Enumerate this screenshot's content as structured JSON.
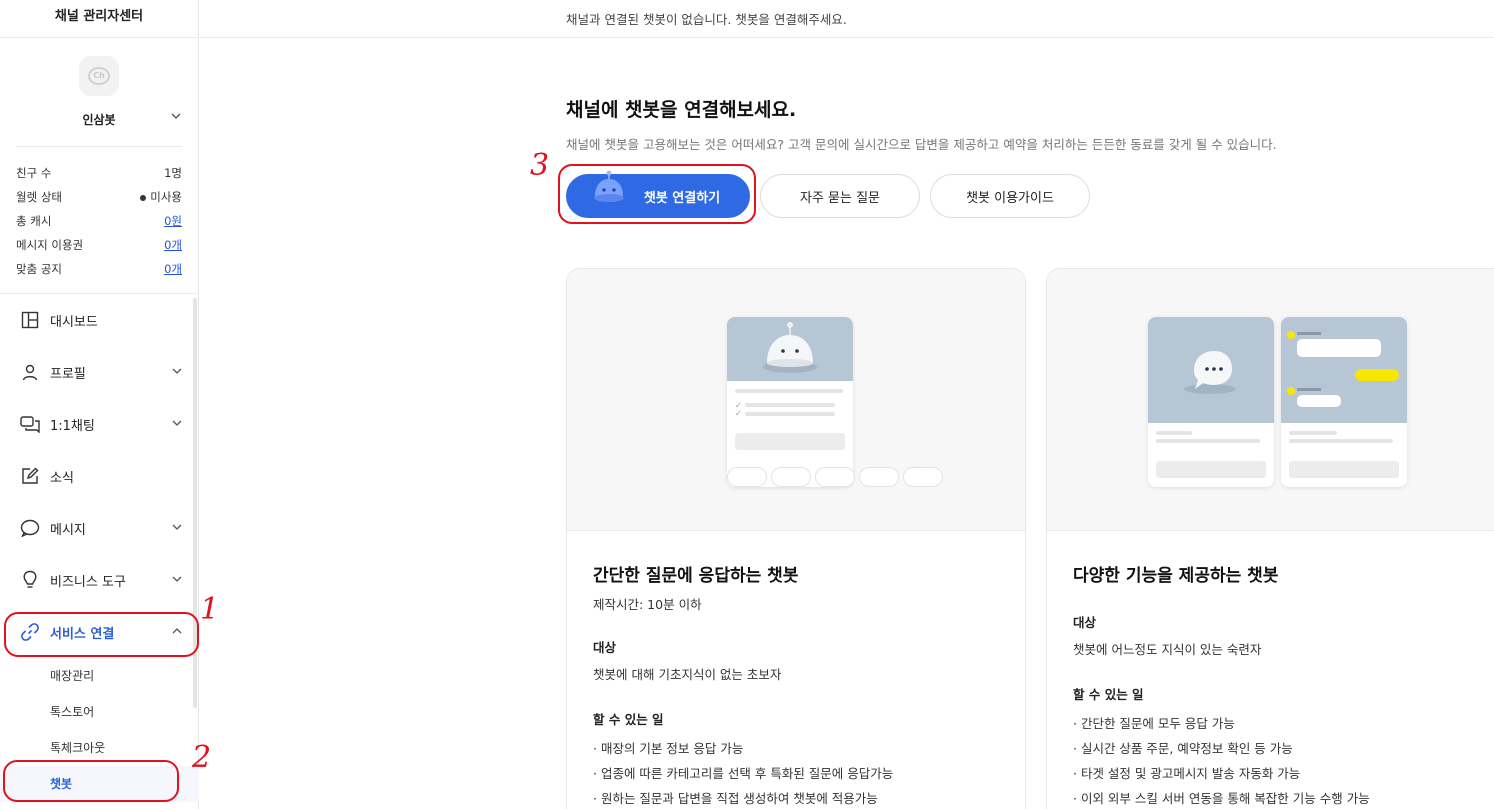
{
  "sidebar": {
    "title": "채널 관리자센터",
    "channel_name": "인삼봇",
    "stats": [
      {
        "label": "친구 수",
        "value": "1명"
      },
      {
        "label": "월렛 상태",
        "value": "미사용"
      },
      {
        "label": "총 캐시",
        "value": "0원"
      },
      {
        "label": "메시지 이용권",
        "value": "0개"
      },
      {
        "label": "맞춤 공지",
        "value": "0개"
      }
    ],
    "nav": {
      "dashboard": "대시보드",
      "profile": "프로필",
      "chat": "1:1채팅",
      "news": "소식",
      "message": "메시지",
      "business": "비즈니스 도구",
      "service": "서비스 연결"
    },
    "sub": {
      "store": "매장관리",
      "toss": "톡스토어",
      "checkout": "톡체크아웃",
      "chatbot": "챗봇"
    }
  },
  "main": {
    "notice": "채널과 연결된 챗봇이 없습니다. 챗봇을 연결해주세요.",
    "heading": "채널에 챗봇을 연결해보세요.",
    "description": "채널에 챗봇을 고용해보는 것은 어떠세요? 고객 문의에 실시간으로 답변을 제공하고 예약을 처리하는 든든한 동료를 갖게 될 수 있습니다.",
    "buttons": {
      "connect": "챗봇 연결하기",
      "faq": "자주 묻는 질문",
      "guide": "챗봇 이용가이드"
    },
    "cards": [
      {
        "title": "간단한 질문에 응답하는 챗봇",
        "meta": "제작시간: 10분 이하",
        "target_label": "대상",
        "target": "챗봇에 대해 기초지식이 없는 초보자",
        "can_do_label": "할 수 있는 일",
        "can_do": [
          "· 매장의 기본 정보 응답 가능",
          "· 업종에 따른 카테고리를 선택 후 특화된 질문에 응답가능",
          "· 원하는 질문과 답변을 직접 생성하여 챗봇에 적용가능"
        ]
      },
      {
        "title": "다양한 기능을 제공하는 챗봇",
        "target_label": "대상",
        "target": "챗봇에 어느정도 지식이 있는 숙련자",
        "can_do_label": "할 수 있는 일",
        "can_do": [
          "· 간단한 질문에 모두 응답 가능",
          "· 실시간 상품 주문, 예약정보 확인 등 가능",
          "· 타겟 설정 및 광고메시지 발송 자동화 가능",
          "· 이외 외부 스킬 서버 연동을 통해 복잡한 기능 수행 가능"
        ]
      }
    ]
  },
  "annotations": {
    "one": "1",
    "two": "2",
    "three": "3"
  },
  "colors": {
    "primary": "#2f6ae4",
    "active_nav": "#2a5fd8",
    "annotation": "#e0121e",
    "illus_blue": "#b7c6d4",
    "yellow": "#f7e600"
  }
}
